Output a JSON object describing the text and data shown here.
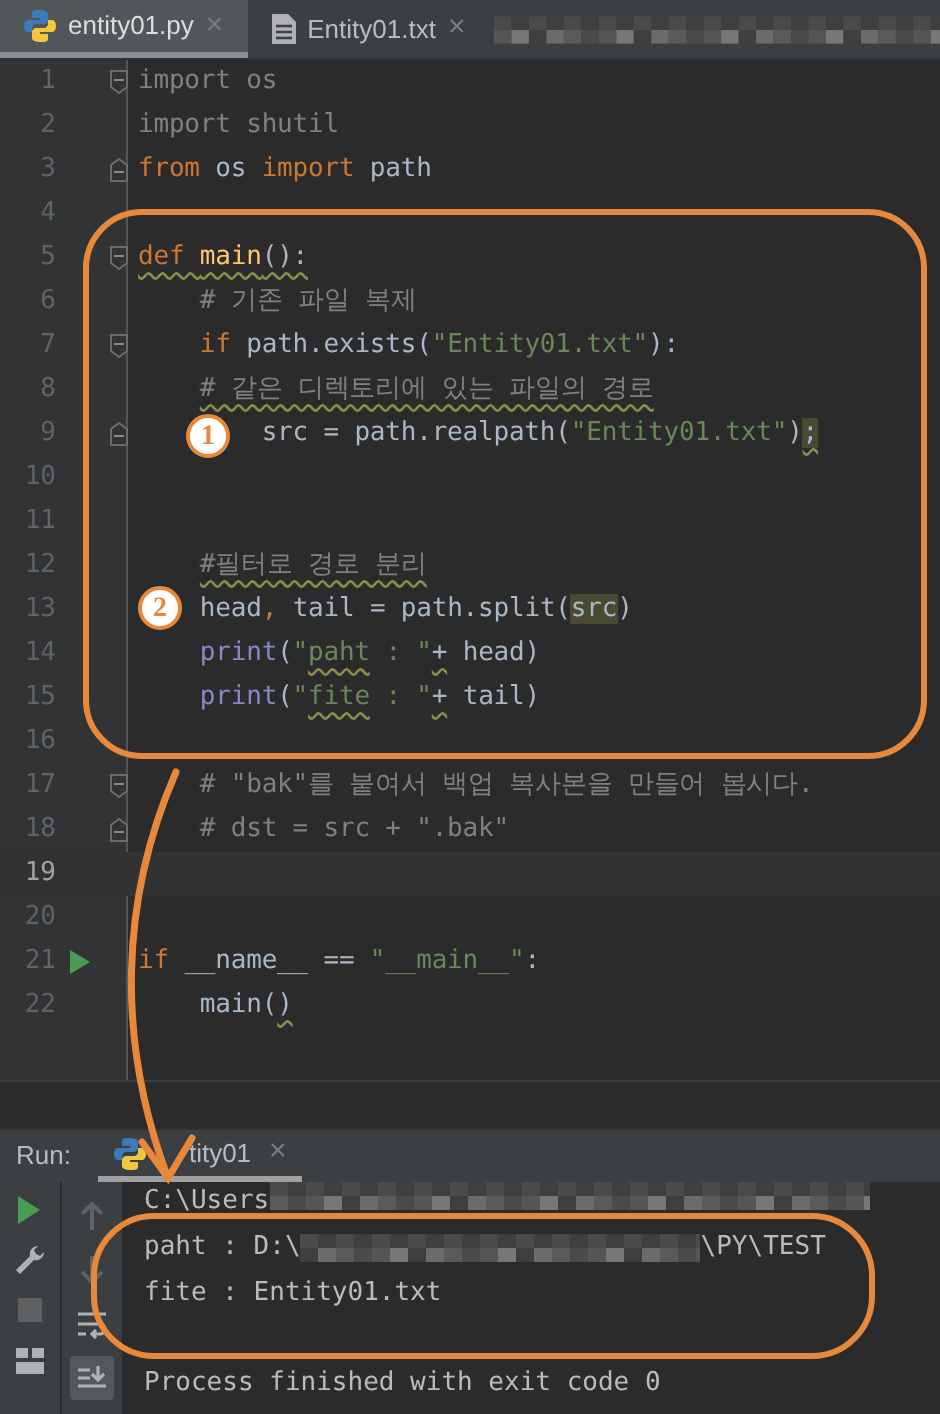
{
  "editor_tabs": [
    {
      "kind": "python",
      "label": "entity01.py",
      "close": "×",
      "selected": true
    },
    {
      "kind": "text",
      "label": "Entity01.txt",
      "close": "×",
      "selected": false
    }
  ],
  "blurred_tabs": true,
  "code_lines": [
    {
      "number": "1",
      "fold_start": true,
      "current": false,
      "tokens": [
        {
          "kind": "unused",
          "text": "import os"
        }
      ]
    },
    {
      "number": "2",
      "current": false,
      "tokens": [
        {
          "kind": "unused",
          "text": "import shutil"
        }
      ]
    },
    {
      "number": "3",
      "fold_end": true,
      "current": false,
      "tokens": [
        {
          "kind": "keyword",
          "text": "from "
        },
        {
          "kind": "plain",
          "text": "os "
        },
        {
          "kind": "keyword",
          "text": "import "
        },
        {
          "kind": "plain",
          "text": "path"
        }
      ]
    },
    {
      "number": "4",
      "current": false
    },
    {
      "number": "5",
      "fold_start": true,
      "current": false,
      "tokens": [
        {
          "kind": "keyword",
          "text": "def ",
          "squiggle": true
        },
        {
          "kind": "function",
          "text": "main",
          "squiggle": true
        },
        {
          "kind": "plain",
          "text": "():",
          "squiggle": true
        }
      ]
    },
    {
      "number": "6",
      "current": false,
      "tokens": [
        {
          "kind": "comment",
          "text": "    # 기존 파일 복제"
        }
      ]
    },
    {
      "number": "7",
      "fold_start": true,
      "current": false,
      "tokens": [
        {
          "kind": "keyword",
          "text": "    if "
        },
        {
          "kind": "plain",
          "text": "path.exists("
        },
        {
          "kind": "string",
          "text": "\"Entity01.txt\""
        },
        {
          "kind": "plain",
          "text": "):"
        }
      ]
    },
    {
      "number": "8",
      "current": false,
      "tokens": [
        {
          "kind": "comment",
          "text": "    # 같은 디렉토리에 있는 파일의 경로",
          "squiggle": true
        }
      ]
    },
    {
      "number": "9",
      "fold_end": true,
      "current": false,
      "tokens": [
        {
          "kind": "plain",
          "text": "        src = path.realpath("
        },
        {
          "kind": "string",
          "text": "\"Entity01.txt\""
        },
        {
          "kind": "plain",
          "text": ")"
        },
        {
          "kind": "highlight",
          "text": ";",
          "squiggle": true
        }
      ]
    },
    {
      "number": "10",
      "current": false
    },
    {
      "number": "11",
      "current": false
    },
    {
      "number": "12",
      "current": false,
      "tokens": [
        {
          "kind": "comment",
          "text": "    #필터로 경로 분리",
          "squiggle": true
        }
      ]
    },
    {
      "number": "13",
      "current": false,
      "tokens": [
        {
          "kind": "plain",
          "text": "    head"
        },
        {
          "kind": "keyword",
          "text": ", "
        },
        {
          "kind": "plain",
          "text": "tail = path.split("
        },
        {
          "kind": "highlight",
          "text": "src"
        },
        {
          "kind": "plain",
          "text": ")"
        }
      ]
    },
    {
      "number": "14",
      "current": false,
      "tokens": [
        {
          "kind": "builtin",
          "text": "    print"
        },
        {
          "kind": "plain",
          "text": "("
        },
        {
          "kind": "string",
          "text": "\""
        },
        {
          "kind": "string",
          "text": "paht",
          "squiggle": true
        },
        {
          "kind": "string",
          "text": " : \""
        },
        {
          "kind": "plain",
          "text": "+",
          "squiggle": true
        },
        {
          "kind": "plain",
          "text": " head)"
        }
      ]
    },
    {
      "number": "15",
      "current": false,
      "tokens": [
        {
          "kind": "builtin",
          "text": "    print"
        },
        {
          "kind": "plain",
          "text": "("
        },
        {
          "kind": "string",
          "text": "\""
        },
        {
          "kind": "string",
          "text": "fite",
          "squiggle": true
        },
        {
          "kind": "string",
          "text": " : \""
        },
        {
          "kind": "plain",
          "text": "+",
          "squiggle": true
        },
        {
          "kind": "plain",
          "text": " tail)"
        }
      ]
    },
    {
      "number": "16",
      "current": false
    },
    {
      "number": "17",
      "fold_start": true,
      "current": false,
      "tokens": [
        {
          "kind": "comment",
          "text": "    # \"bak\"를 붙여서 백업 복사본을 만들어 봅시다."
        }
      ]
    },
    {
      "number": "18",
      "fold_end": true,
      "current": false,
      "tokens": [
        {
          "kind": "comment",
          "text": "    # dst = src + \".bak\""
        }
      ]
    },
    {
      "number": "19",
      "current": true
    },
    {
      "number": "20",
      "current": false
    },
    {
      "number": "21",
      "run_marker": true,
      "current": false,
      "tokens": [
        {
          "kind": "keyword",
          "text": "if "
        },
        {
          "kind": "plain",
          "text": "__name__ == "
        },
        {
          "kind": "string",
          "text": "\"__main__\""
        },
        {
          "kind": "plain",
          "text": ":"
        }
      ]
    },
    {
      "number": "22",
      "current": false,
      "tokens": [
        {
          "kind": "plain",
          "text": "    main("
        },
        {
          "kind": "plain",
          "text": ")",
          "squiggle": true
        }
      ]
    }
  ],
  "run_panel": {
    "label": "Run:",
    "tab": {
      "label": "tity01",
      "close": "×"
    },
    "console_lines": [
      {
        "segments": [
          {
            "kind": "text",
            "text": "C:\\Users"
          },
          {
            "kind": "blur"
          }
        ]
      },
      {
        "segments": [
          {
            "kind": "text",
            "text": "paht : D:\\"
          },
          {
            "kind": "blur"
          },
          {
            "kind": "text",
            "text": "\\PY\\TEST"
          }
        ]
      },
      {
        "segments": [
          {
            "kind": "text",
            "text": "fite : Entity01.txt"
          }
        ]
      },
      {
        "segments": [
          {
            "kind": "text",
            "text": "Process finished with exit code 0"
          }
        ]
      }
    ]
  },
  "annotations": {
    "badges": [
      {
        "number": "1"
      },
      {
        "number": "2"
      }
    ]
  }
}
